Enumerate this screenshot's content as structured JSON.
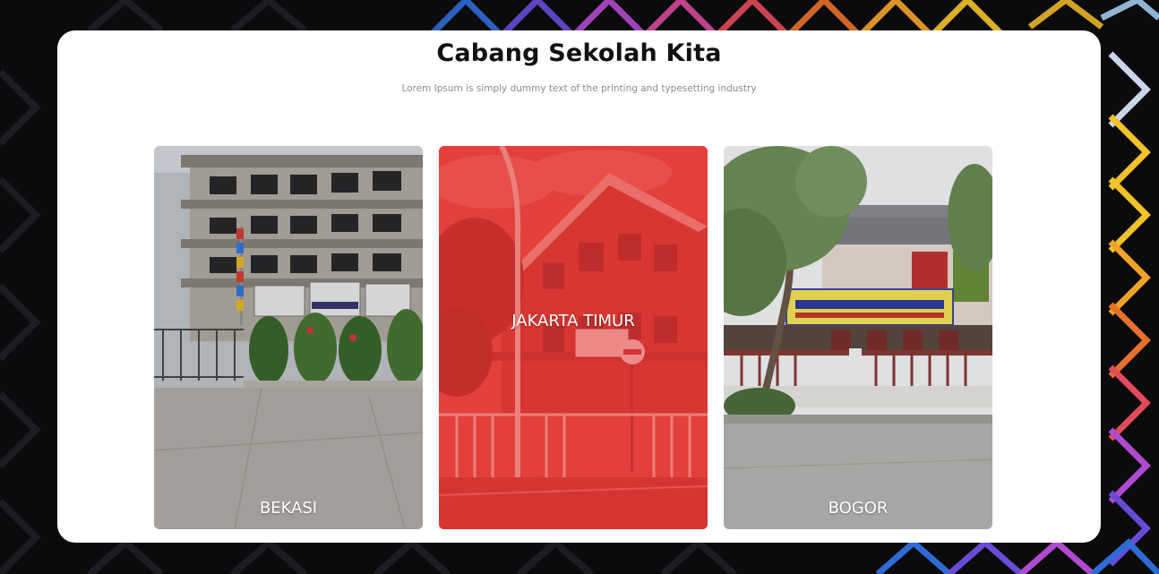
{
  "section": {
    "title": "Cabang Sekolah Kita",
    "subtitle": "Lorem Ipsum is simply dummy text of the printing and typesetting industry"
  },
  "branches": [
    {
      "label": "BEKASI",
      "active": false
    },
    {
      "label": "JAKARTA TIMUR",
      "active": true
    },
    {
      "label": "BOGOR",
      "active": false
    }
  ],
  "colors": {
    "panel": "#ffffff",
    "overlay_active": "#e53935",
    "background": "#0b0b0d"
  }
}
